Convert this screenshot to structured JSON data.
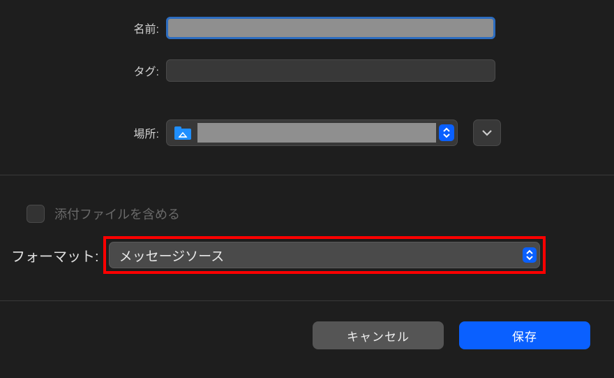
{
  "labels": {
    "name": "名前:",
    "tag": "タグ:",
    "location": "場所:",
    "include_attachments": "添付ファイルを含める",
    "format": "フォーマット:"
  },
  "fields": {
    "name_value": "",
    "tag_value": "",
    "location_value": ""
  },
  "format": {
    "selected": "メッセージソース"
  },
  "buttons": {
    "cancel": "キャンセル",
    "save": "保存"
  }
}
